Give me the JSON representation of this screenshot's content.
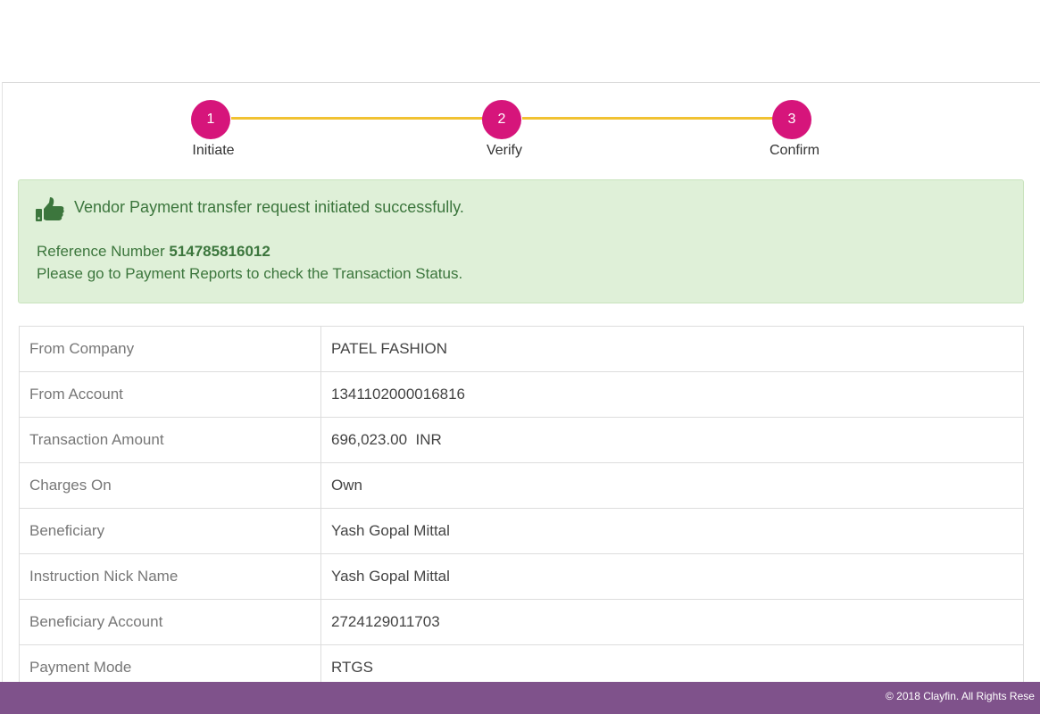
{
  "stepper": {
    "steps": [
      {
        "number": "1",
        "label": "Initiate"
      },
      {
        "number": "2",
        "label": "Verify"
      },
      {
        "number": "3",
        "label": "Confirm"
      }
    ],
    "colors": {
      "circle": "#d6157b",
      "line": "#f1c232"
    }
  },
  "alert": {
    "icon": "thumbs-up-icon",
    "message": "Vendor Payment transfer request initiated successfully.",
    "reference_label": "Reference Number",
    "reference_number": "514785816012",
    "note": "Please go to Payment Reports to check the Transaction Status.",
    "colors": {
      "background": "#dff0d8",
      "text": "#3c763d"
    }
  },
  "details": {
    "rows": [
      {
        "label": "From Company",
        "value": "PATEL FASHION"
      },
      {
        "label": "From Account",
        "value": "1341102000016816"
      },
      {
        "label": "Transaction Amount",
        "value": "696,023.00  INR"
      },
      {
        "label": "Charges On",
        "value": "Own"
      },
      {
        "label": "Beneficiary",
        "value": "Yash Gopal Mittal"
      },
      {
        "label": "Instruction Nick Name",
        "value": "Yash Gopal Mittal"
      },
      {
        "label": "Beneficiary Account",
        "value": "2724129011703"
      },
      {
        "label": "Payment Mode",
        "value": "RTGS"
      }
    ]
  },
  "footer": {
    "text": "© 2018 Clayfin. All Rights Rese",
    "color": "#7f528b"
  }
}
